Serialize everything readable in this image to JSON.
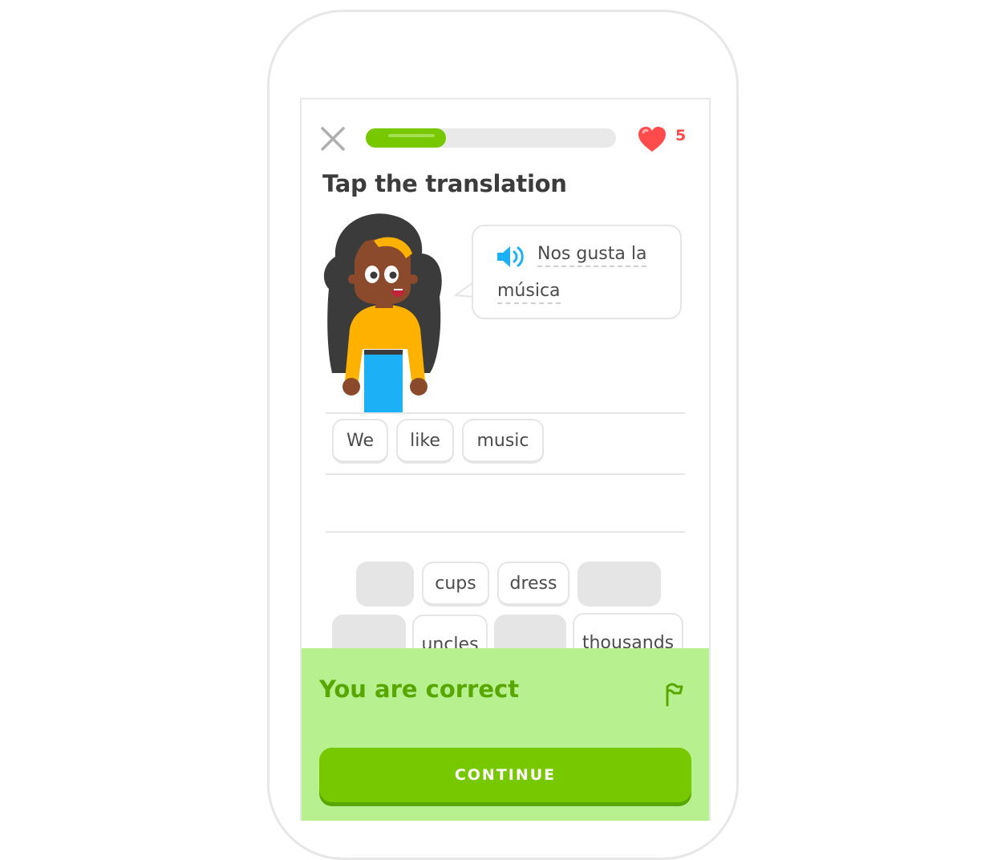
{
  "header": {
    "lives": "5",
    "progress_fraction": 0.32
  },
  "prompt": {
    "title": "Tap the translation",
    "sentence_line1": "Nos gusta la",
    "sentence_line2": "música"
  },
  "answer": {
    "tiles": [
      "We",
      "like",
      "music"
    ]
  },
  "word_bank": {
    "row1": [
      "",
      "cups",
      "dress",
      ""
    ],
    "row2": [
      "",
      "uncles",
      "",
      "thousands"
    ]
  },
  "feedback": {
    "title": "You are correct",
    "continue_label": "CONTINUE"
  },
  "colors": {
    "accent_green": "#78c800",
    "feedback_background": "#b7f08f",
    "feedback_text": "#58a700",
    "heart_red": "#ff4b4b",
    "speaker_blue": "#1cb0f6"
  }
}
